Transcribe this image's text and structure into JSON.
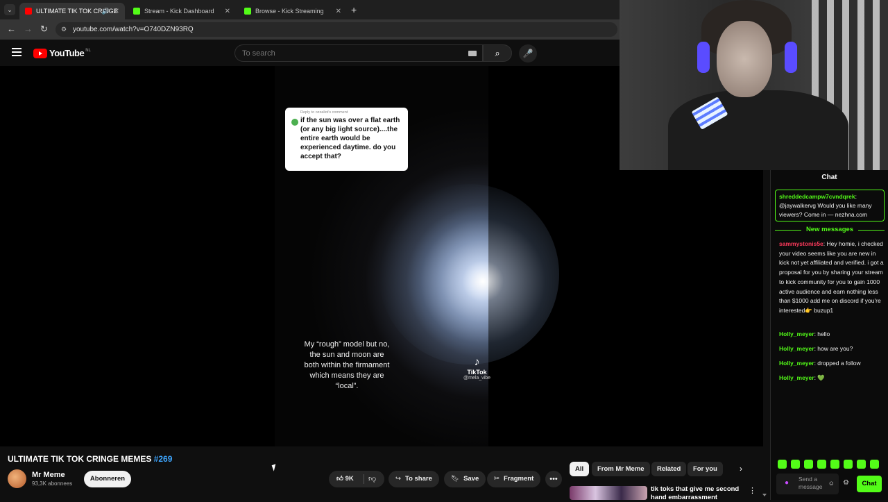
{
  "browser": {
    "tabs": [
      {
        "title": "ULTIMATE TIK TOK CRINGE",
        "active": true
      },
      {
        "title": "Stream - Kick Dashboard",
        "active": false
      },
      {
        "title": "Browse - Kick Streaming",
        "active": false
      }
    ],
    "url": "youtube.com/watch?v=O740DZN93RQ"
  },
  "youtube": {
    "logo_text": "YouTube",
    "region": "NL",
    "search_placeholder": "To search"
  },
  "video": {
    "comment_reply": "Reply to ozzaliot's comment",
    "comment_text": "if the sun was over a flat earth (or any big light source)....the entire earth would be experienced daytime. do you accept that?",
    "caption": "My “rough” model but no, the sun and moon are both within the firmament which means they are “local”.",
    "tiktok_label": "TikTok",
    "tiktok_handle": "@mela_vibe"
  },
  "title": {
    "main": "ULTIMATE TIK TOK CRINGE MEMES",
    "tag": "#269"
  },
  "channel": {
    "name": "Mr Meme",
    "subs": "93,3K abonnees",
    "subscribe_label": "Abonneren"
  },
  "actions": {
    "likes": "9K",
    "share": "To share",
    "save": "Save",
    "fragment": "Fragment"
  },
  "chips": [
    "All",
    "From Mr Meme",
    "Related",
    "For you"
  ],
  "related": {
    "title": "tik toks that give me second hand embarrassment"
  },
  "chat": {
    "title": "Chat",
    "pinned_user": "shreddedcampw7cvndqrek",
    "pinned_text": "@jaywalkervg Would you like many viewers? Come in — nezhna.com",
    "new_messages": "New messages",
    "messages": [
      {
        "user": "sammystonis5e",
        "text": "Hey homie, i checked your video seems like you are new in kick not yet affiliated and verified. i got a proposal for you by sharing your stream to kick community for you to gain 1000 active audience and earn nothing less than $1000 add me on discord if you're interested👉 buzup1"
      },
      {
        "user": "Holly_meyer",
        "text": "hello"
      },
      {
        "user": "Holly_meyer",
        "text": "how are you?"
      },
      {
        "user": "Holly_meyer",
        "text": "dropped a follow"
      },
      {
        "user": "Holly_meyer",
        "text": "💚"
      }
    ],
    "input_placeholder": "Send a message",
    "send_label": "Chat"
  },
  "colors": {
    "kick_green": "#53fc18",
    "yt_red": "#ff0000",
    "link_blue": "#3ea6ff"
  }
}
